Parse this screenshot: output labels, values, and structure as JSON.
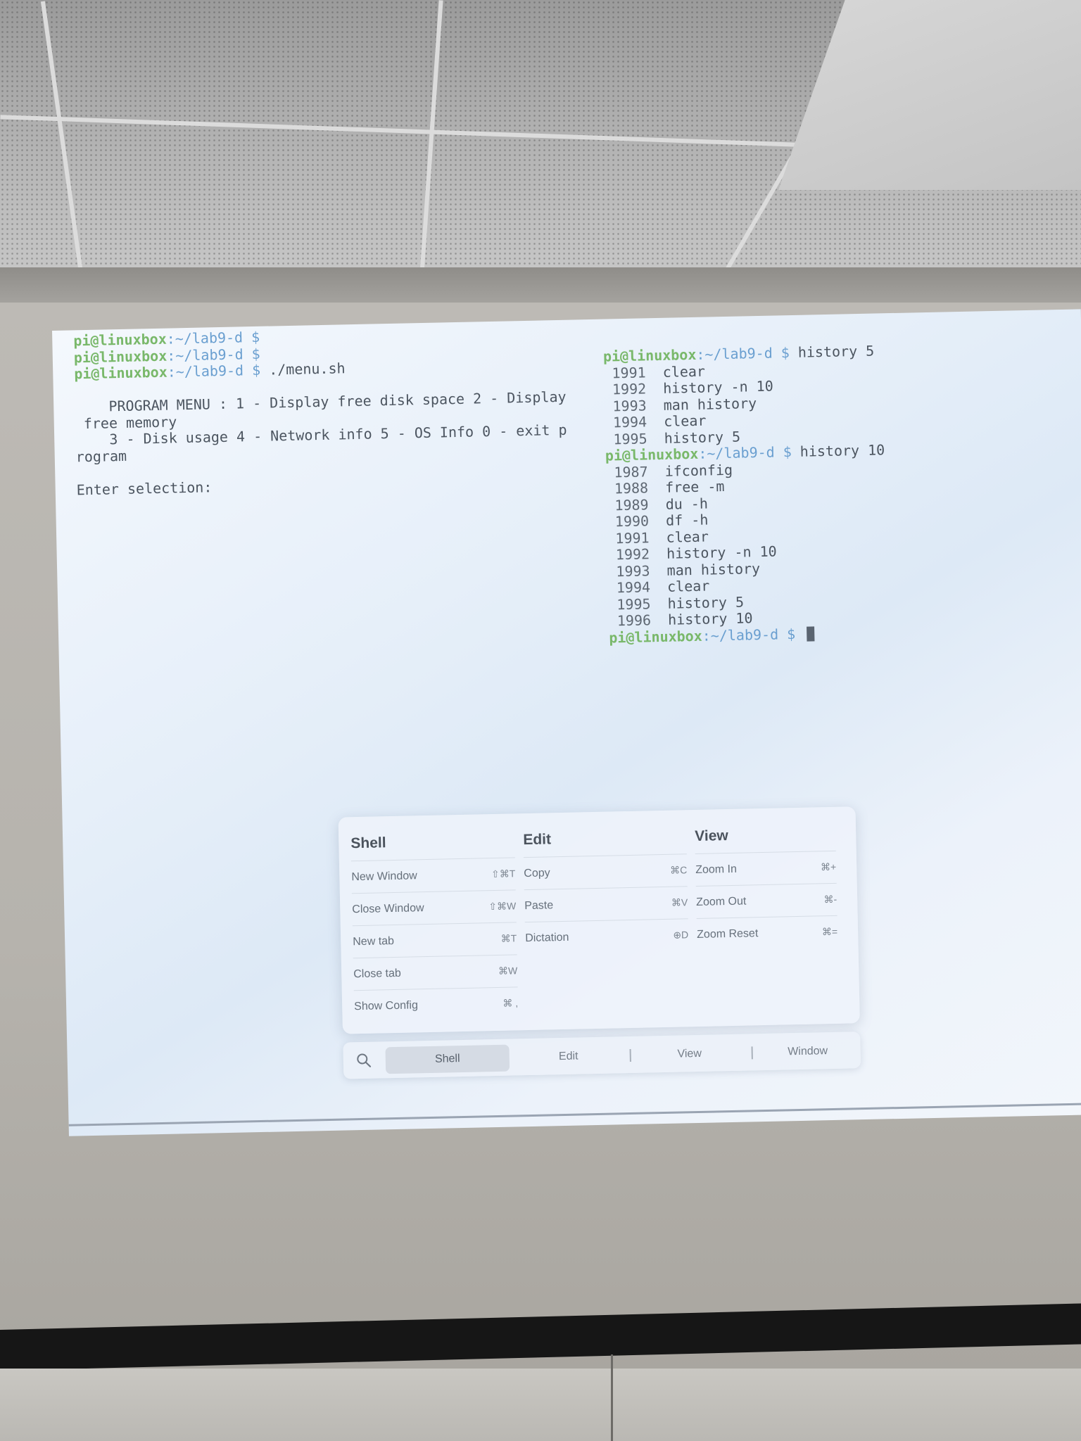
{
  "terminal_left": {
    "lines": [
      {
        "user": "pi@linuxbox",
        "path": ":~/lab9-d $",
        "cmd": ""
      },
      {
        "user": "pi@linuxbox",
        "path": ":~/lab9-d $",
        "cmd": ""
      },
      {
        "user": "pi@linuxbox",
        "path": ":~/lab9-d $",
        "cmd": " ./menu.sh"
      }
    ],
    "menu_lines": [
      "",
      "    PROGRAM MENU : 1 - Display free disk space 2 - Display",
      " free memory",
      "    3 - Disk usage 4 - Network info 5 - OS Info 0 - exit p",
      "rogram",
      "",
      "Enter selection:"
    ]
  },
  "terminal_right": {
    "block1_prompt": {
      "user": "pi@linuxbox",
      "path": ":~/lab9-d $",
      "cmd": " history 5"
    },
    "block1": [
      {
        "num": "1991",
        "cmd": "clear"
      },
      {
        "num": "1992",
        "cmd": "history -n 10"
      },
      {
        "num": "1993",
        "cmd": "man history"
      },
      {
        "num": "1994",
        "cmd": "clear"
      },
      {
        "num": "1995",
        "cmd": "history 5"
      }
    ],
    "block2_prompt": {
      "user": "pi@linuxbox",
      "path": ":~/lab9-d $",
      "cmd": " history 10"
    },
    "block2": [
      {
        "num": "1987",
        "cmd": "ifconfig"
      },
      {
        "num": "1988",
        "cmd": "free -m"
      },
      {
        "num": "1989",
        "cmd": "du -h"
      },
      {
        "num": "1990",
        "cmd": "df -h"
      },
      {
        "num": "1991",
        "cmd": "clear"
      },
      {
        "num": "1992",
        "cmd": "history -n 10"
      },
      {
        "num": "1993",
        "cmd": "man history"
      },
      {
        "num": "1994",
        "cmd": "clear"
      },
      {
        "num": "1995",
        "cmd": "history 5"
      },
      {
        "num": "1996",
        "cmd": "history 10"
      }
    ],
    "final_prompt": {
      "user": "pi@linuxbox",
      "path": ":~/lab9-d $",
      "cmd": " "
    }
  },
  "palette": {
    "shell": {
      "title": "Shell",
      "items": [
        {
          "label": "New Window",
          "key": "⇧⌘T"
        },
        {
          "label": "Close Window",
          "key": "⇧⌘W"
        },
        {
          "label": "New tab",
          "key": "⌘T"
        },
        {
          "label": "Close tab",
          "key": "⌘W"
        },
        {
          "label": "Show Config",
          "key": "⌘ ,"
        }
      ]
    },
    "edit": {
      "title": "Edit",
      "items": [
        {
          "label": "Copy",
          "key": "⌘C"
        },
        {
          "label": "Paste",
          "key": "⌘V"
        },
        {
          "label": "Dictation",
          "key": "⊕D"
        }
      ]
    },
    "view": {
      "title": "View",
      "items": [
        {
          "label": "Zoom In",
          "key": "⌘+"
        },
        {
          "label": "Zoom Out",
          "key": "⌘-"
        },
        {
          "label": "Zoom Reset",
          "key": "⌘="
        }
      ]
    }
  },
  "tabs": {
    "search_icon": "search-icon",
    "items": [
      "Shell",
      "Edit",
      "View",
      "Window"
    ],
    "active": "Shell"
  }
}
